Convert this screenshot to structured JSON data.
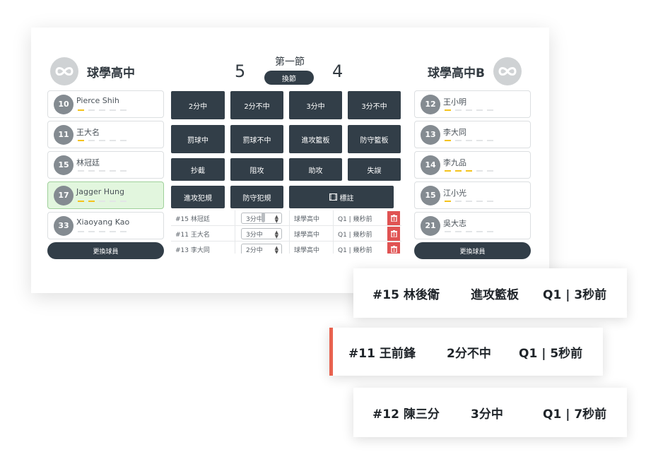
{
  "home_team": {
    "name": "球學高中",
    "score": "5"
  },
  "away_team": {
    "name": "球學高中B",
    "score": "4"
  },
  "period": {
    "label": "第一節",
    "switch_label": "換節"
  },
  "home_roster": [
    {
      "number": "10",
      "name": "Pierce Shih",
      "fouls": 1,
      "active": false
    },
    {
      "number": "11",
      "name": "王大名",
      "fouls": 1,
      "active": false
    },
    {
      "number": "15",
      "name": "林冠廷",
      "fouls": 0,
      "active": false
    },
    {
      "number": "17",
      "name": "Jagger Hung",
      "fouls": 2,
      "active": true
    },
    {
      "number": "33",
      "name": "Xiaoyang Kao",
      "fouls": 0,
      "active": false
    }
  ],
  "away_roster": [
    {
      "number": "12",
      "name": "王小明",
      "fouls": 1,
      "active": false
    },
    {
      "number": "13",
      "name": "李大同",
      "fouls": 1,
      "active": false
    },
    {
      "number": "14",
      "name": "李九品",
      "fouls": 3,
      "active": false
    },
    {
      "number": "15",
      "name": "江小光",
      "fouls": 1,
      "active": false
    },
    {
      "number": "21",
      "name": "吳大志",
      "fouls": 0,
      "active": false
    }
  ],
  "change_player_label": "更換球員",
  "actions": {
    "two_made": "2分中",
    "two_miss": "2分不中",
    "three_made": "3分中",
    "three_miss": "3分不中",
    "ft_made": "罰球中",
    "ft_miss": "罰球不中",
    "off_reb": "進攻籃板",
    "def_reb": "防守籃板",
    "steal": "抄截",
    "block": "阻攻",
    "assist": "助攻",
    "turnover": "失誤",
    "off_foul": "進攻犯規",
    "def_foul": "防守犯規",
    "mark": "標註"
  },
  "log": [
    {
      "player": "#15 林冠廷",
      "action": "3分中",
      "team": "球學高中",
      "time": "Q1 | 幾秒前"
    },
    {
      "player": "#11 王大名",
      "action": "3分中",
      "team": "球學高中",
      "time": "Q1 | 幾秒前"
    },
    {
      "player": "#13 李大同",
      "action": "2分中",
      "team": "球學高中",
      "time": "Q1 | 幾秒前"
    }
  ],
  "notifications": [
    {
      "player": "#15  林後衛",
      "action": "進攻籃板",
      "time": "Q1 | 3秒前"
    },
    {
      "player": "#11  王前鋒",
      "action": "2分不中",
      "time": "Q1 | 5秒前"
    },
    {
      "player": "#12  陳三分",
      "action": "3分中",
      "time": "Q1 | 7秒前"
    }
  ],
  "colors": {
    "dark": "#323e48",
    "foul_on": "#f4c31c",
    "active_bg": "#e2f6de",
    "delete": "#e05353",
    "toast_accent": "#e8624f"
  },
  "icons": {
    "logo": "infinity-logo-icon",
    "mark": "film-icon",
    "delete": "trash-icon",
    "select": "stepper-arrows-icon"
  }
}
